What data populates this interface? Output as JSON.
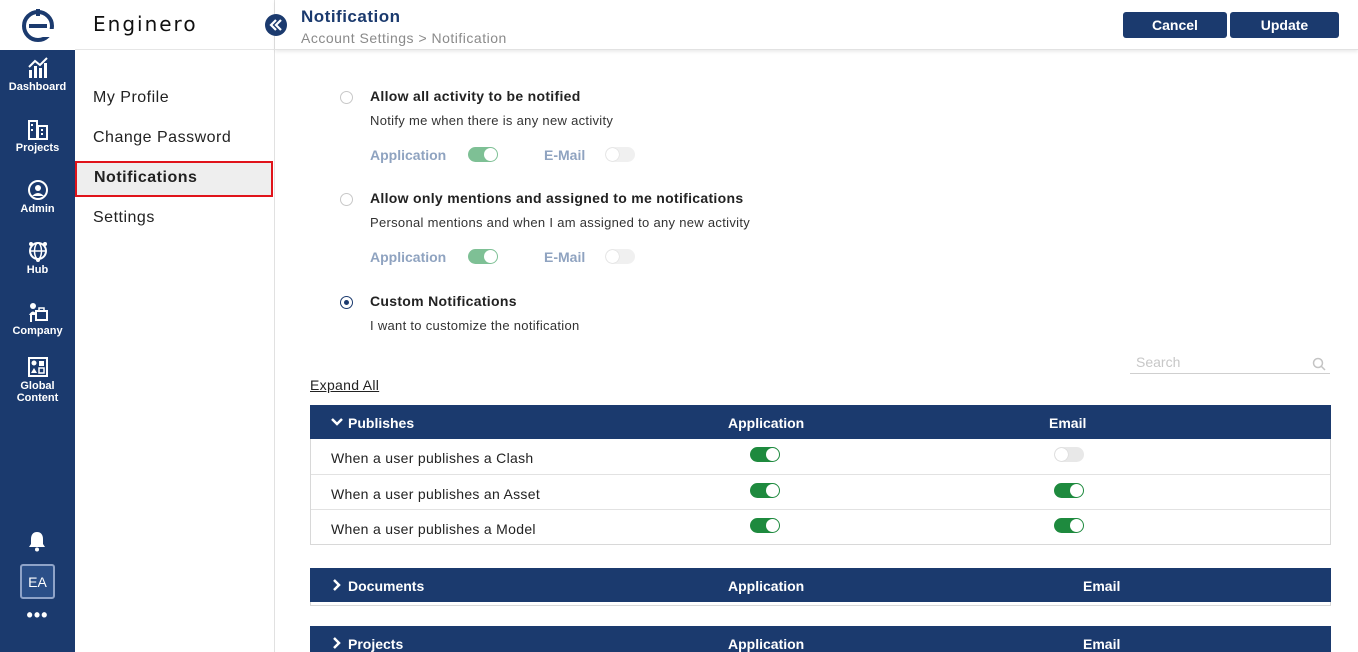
{
  "brand": {
    "name": "Enginero"
  },
  "rail": {
    "items": [
      {
        "label": "Dashboard"
      },
      {
        "label": "Projects"
      },
      {
        "label": "Admin"
      },
      {
        "label": "Hub"
      },
      {
        "label": "Company"
      },
      {
        "label_line1": "Global",
        "label_line2": "Content"
      }
    ],
    "avatar": "EA",
    "more": "•••"
  },
  "sidebar": {
    "items": [
      {
        "label": "My Profile"
      },
      {
        "label": "Change Password"
      },
      {
        "label": "Notifications",
        "active": true
      },
      {
        "label": "Settings"
      }
    ]
  },
  "header": {
    "title": "Notification",
    "breadcrumb": "Account Settings > Notification",
    "cancel_label": "Cancel",
    "update_label": "Update"
  },
  "options": [
    {
      "title": "Allow all activity to be notified",
      "desc": "Notify me when there is any new activity",
      "selected": false,
      "app_label": "Application",
      "app_on": true,
      "email_label": "E-Mail",
      "email_on": false
    },
    {
      "title": "Allow only mentions and assigned to me notifications",
      "desc": "Personal mentions and when I am assigned to any new activity",
      "selected": false,
      "app_label": "Application",
      "app_on": true,
      "email_label": "E-Mail",
      "email_on": false
    },
    {
      "title": "Custom Notifications",
      "desc": "I want to customize the notification",
      "selected": true
    }
  ],
  "search": {
    "placeholder": "Search"
  },
  "expand_all": "Expand All",
  "sections": [
    {
      "title": "Publishes",
      "expanded": true,
      "col_app": "Application",
      "col_email": "Email",
      "rows": [
        {
          "label": "When a user publishes a Clash",
          "app": true,
          "email": false
        },
        {
          "label": "When a user publishes an Asset",
          "app": true,
          "email": true
        },
        {
          "label": "When a user publishes a Model",
          "app": true,
          "email": true
        }
      ]
    },
    {
      "title": "Documents",
      "expanded": false,
      "col_app": "Application",
      "col_email": "Email"
    },
    {
      "title": "Projects",
      "expanded": false,
      "col_app": "Application",
      "col_email": "Email"
    }
  ],
  "colors": {
    "primary": "#1b3a6e",
    "toggle_on": "#1e8a3e",
    "active_border": "#e0131a"
  }
}
